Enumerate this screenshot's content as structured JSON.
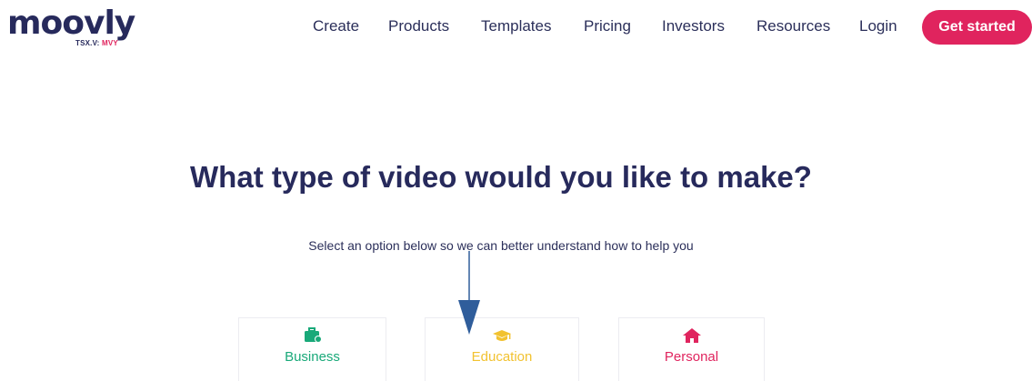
{
  "logo": {
    "wordmark": "moovly",
    "ticker_prefix": "TSX.V: ",
    "ticker_symbol": "MVY"
  },
  "nav": {
    "items": [
      "Create",
      "Products",
      "Templates",
      "Pricing",
      "Investors",
      "Resources",
      "Login"
    ],
    "cta": "Get started"
  },
  "main": {
    "headline": "What type of video would you like to make?",
    "subline": "Select an option below so we can better understand how to help you"
  },
  "options": [
    {
      "label": "Business",
      "icon": "briefcase-icon",
      "color": "#19a979"
    },
    {
      "label": "Education",
      "icon": "graduation-cap-icon",
      "color": "#f2c230"
    },
    {
      "label": "Personal",
      "icon": "home-icon",
      "color": "#e0245e"
    }
  ],
  "colors": {
    "brand_navy": "#272a5c",
    "accent_pink": "#e0245e",
    "annotation_arrow": "#2f5d9b"
  }
}
